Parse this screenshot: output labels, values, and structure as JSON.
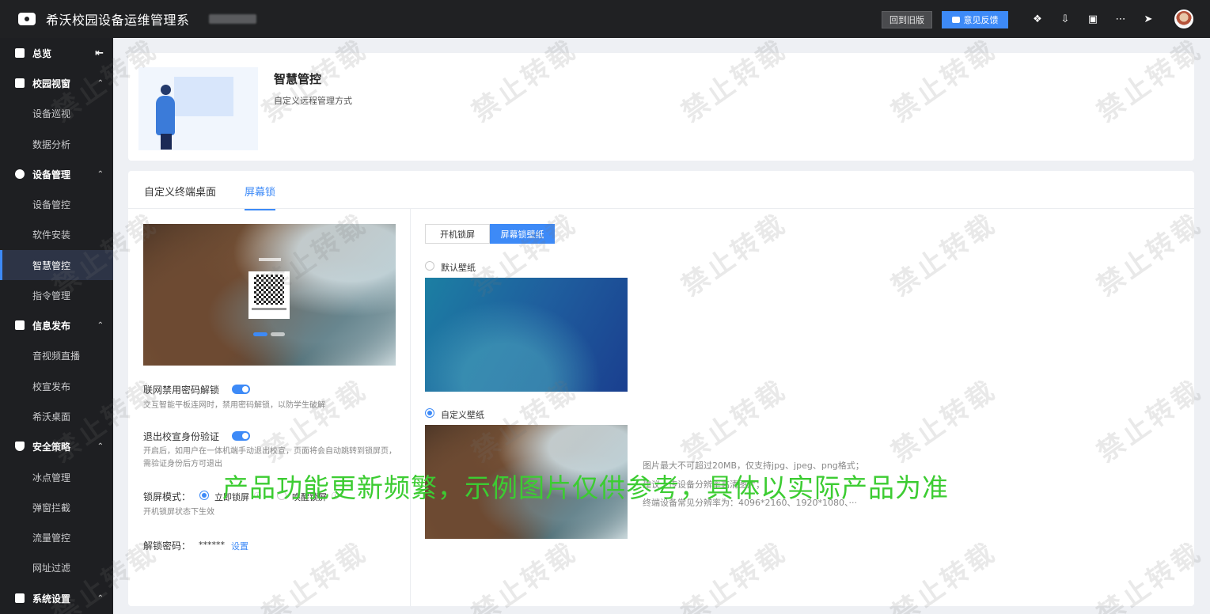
{
  "topbar": {
    "app_title": "希沃校园设备运维管理系",
    "old_version_label": "回到旧版",
    "feedback_label": "意见反馈",
    "icons": [
      "help-icon",
      "download-icon",
      "book-icon",
      "more-icon",
      "send-icon"
    ]
  },
  "sidebar": {
    "overview": "总览",
    "groups": [
      {
        "label": "校园视窗",
        "items": [
          "设备巡视",
          "数据分析"
        ]
      },
      {
        "label": "设备管理",
        "items": [
          "设备管控",
          "软件安装",
          "智慧管控",
          "指令管理"
        ]
      },
      {
        "label": "信息发布",
        "items": [
          "音视频直播",
          "校宣发布",
          "希沃桌面"
        ]
      },
      {
        "label": "安全策略",
        "items": [
          "冰点管理",
          "弹窗拦截",
          "流量管控",
          "网址过滤"
        ]
      },
      {
        "label": "系统设置",
        "items": []
      }
    ],
    "active_item": "智慧管控"
  },
  "header": {
    "title": "智慧管控",
    "subtitle": "自定义远程管理方式"
  },
  "tabs": [
    {
      "label": "自定义终端桌面",
      "active": false
    },
    {
      "label": "屏幕锁",
      "active": true
    }
  ],
  "left_panel": {
    "qr_label": "扫码解锁",
    "options": [
      {
        "label": "联网禁用密码解锁",
        "enabled": true,
        "desc": "交互智能平板连网时，禁用密码解锁，以防学生破解"
      },
      {
        "label": "退出校宣身份验证",
        "enabled": true,
        "desc": "开启后，如用户在一体机端手动退出校宣，页面将会自动跳转到锁屏页，需验证身份后方可退出"
      }
    ],
    "lock_mode": {
      "label": "锁屏模式：",
      "options": [
        "立即锁屏",
        "唤醒锁屏"
      ],
      "selected": "立即锁屏",
      "desc": "开机锁屏状态下生效"
    },
    "password": {
      "label": "解锁密码：",
      "value": "******",
      "action": "设置"
    }
  },
  "right_panel": {
    "segments": [
      "开机锁屏",
      "屏幕锁壁纸"
    ],
    "active_segment": "屏幕锁壁纸",
    "wallpaper_options": [
      "默认壁纸",
      "自定义壁纸"
    ],
    "selected_wallpaper": "自定义壁纸",
    "hints": [
      "图片最大不可超过20MB，仅支持jpg、jpeg、png格式；",
      "建议上传设备分辨率高清图片；",
      "终端设备常见分辨率为：4096*2160、1920*1080、···"
    ]
  },
  "overlay": {
    "watermark": "禁止转载",
    "banner": "产品功能更新频繁，示例图片仅供参考，具体以实际产品为准"
  },
  "colors": {
    "accent": "#3d8af7",
    "topbar": "#202123",
    "sidebar": "#1e1f22",
    "banner": "#3ccc32"
  }
}
